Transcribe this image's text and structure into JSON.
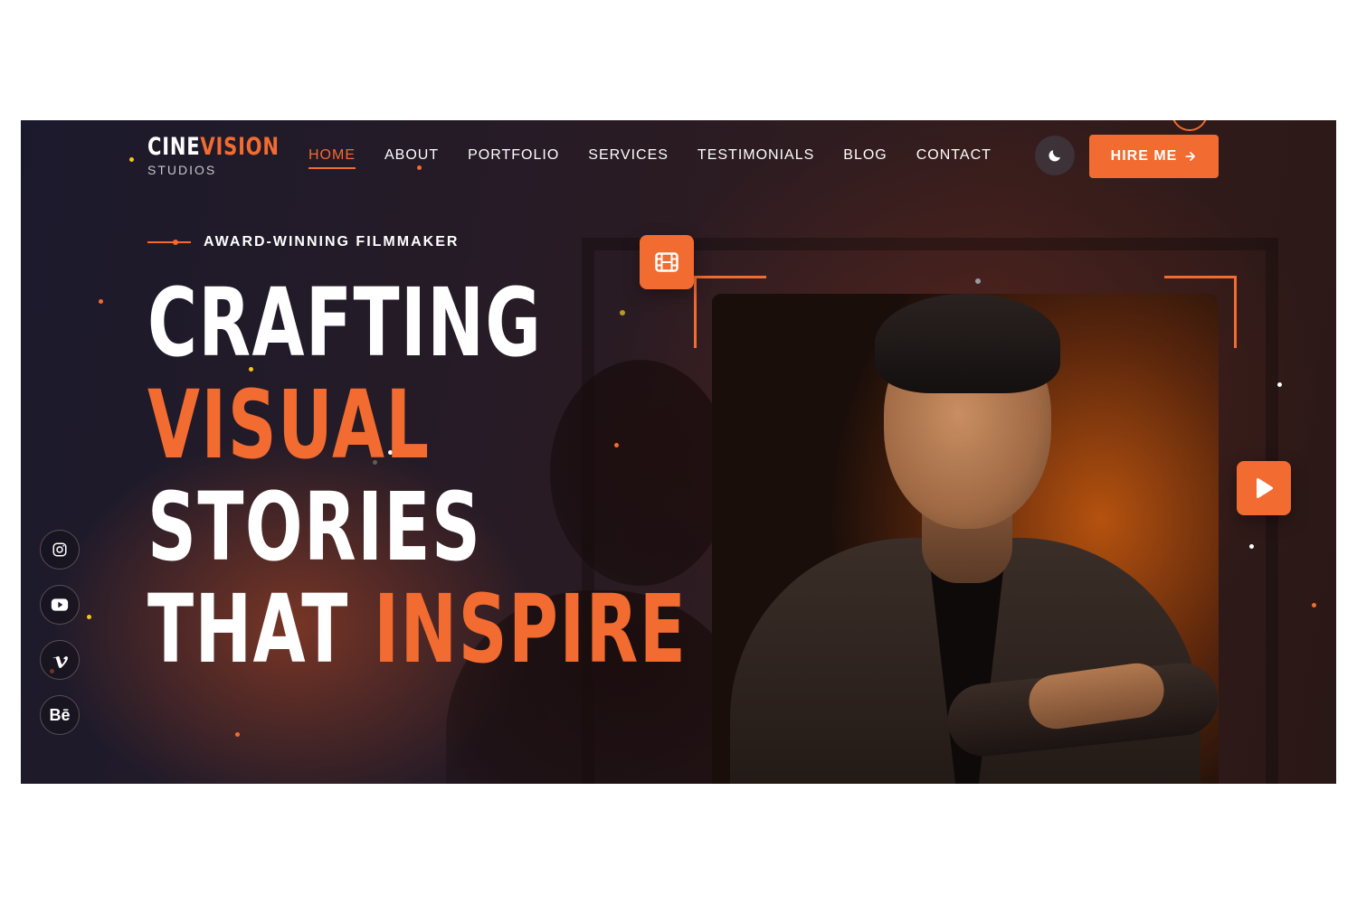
{
  "brand": {
    "name_part1": "CINE",
    "name_part2": "VISION",
    "subtitle": "STUDIOS"
  },
  "nav": {
    "items": [
      {
        "label": "HOME",
        "active": true
      },
      {
        "label": "ABOUT",
        "active": false
      },
      {
        "label": "PORTFOLIO",
        "active": false
      },
      {
        "label": "SERVICES",
        "active": false
      },
      {
        "label": "TESTIMONIALS",
        "active": false
      },
      {
        "label": "BLOG",
        "active": false
      },
      {
        "label": "CONTACT",
        "active": false
      }
    ]
  },
  "header": {
    "theme_toggle_icon": "moon-icon",
    "hire_label": "HIRE ME",
    "hire_icon": "arrow-right-icon"
  },
  "hero": {
    "eyebrow": "AWARD-WINNING FILMMAKER",
    "line1": "CRAFTING",
    "line2": "VISUAL",
    "line3": "STORIES",
    "line4_white": "THAT",
    "line4_orange": "INSPIRE"
  },
  "social": [
    {
      "name": "instagram-icon"
    },
    {
      "name": "youtube-icon"
    },
    {
      "name": "vimeo-icon"
    },
    {
      "name": "behance-icon",
      "label": "Bē"
    }
  ],
  "colors": {
    "accent": "#f26b30",
    "background": "#241a26",
    "text": "#ffffff"
  }
}
